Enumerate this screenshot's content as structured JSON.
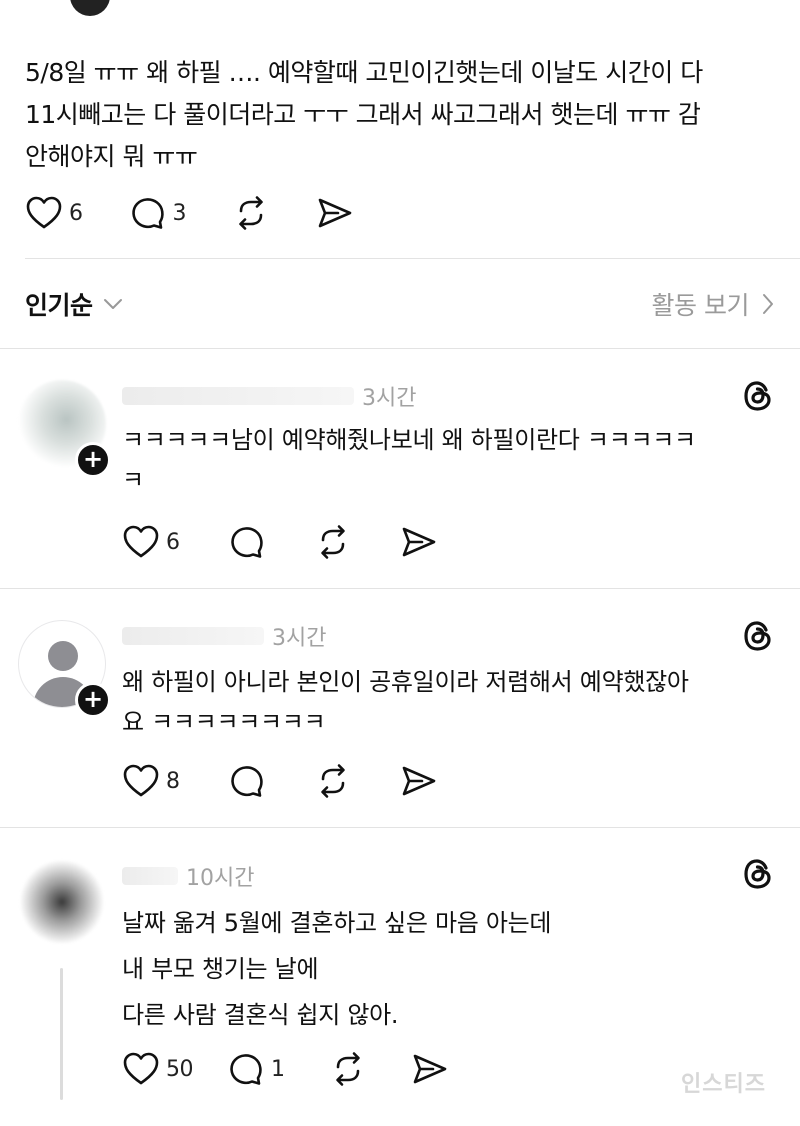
{
  "post": {
    "lines": [
      "5/8일 ㅠㅠ 왜 하필 …. 예약할때 고민이긴햇는데 이날도 시간이 다",
      "11시빼고는 다 풀이더라고 ㅜㅜ 그래서 싸고그래서 햇는데 ㅠㅠ 감",
      "안해야지 뭐 ㅠㅠ"
    ],
    "likes": "6",
    "replies": "3"
  },
  "sort": {
    "label": "인기순",
    "activity_label": "활동 보기"
  },
  "comments": [
    {
      "time": "3시간",
      "lines": [
        "ㅋㅋㅋㅋㅋ남이 예약해줬나보네 왜 하필이란다 ㅋㅋㅋㅋㅋ",
        "ㅋ"
      ],
      "likes": "6",
      "replies": ""
    },
    {
      "time": "3시간",
      "lines": [
        "왜 하필이 아니라 본인이 공휴일이라 저렴해서 예약했잖아",
        "요 ㅋㅋㅋㅋㅋㅋㅋㅋ"
      ],
      "likes": "8",
      "replies": ""
    },
    {
      "time": "10시간",
      "lines": [
        "날짜 옮겨 5월에 결혼하고 싶은 마음 아는데",
        "내 부모 챙기는 날에",
        "다른 사람 결혼식 쉽지 않아."
      ],
      "likes": "50",
      "replies": "1"
    }
  ],
  "watermark": "인스티즈",
  "icons": {
    "like": "heart-icon",
    "reply": "comment-bubble-icon",
    "repost": "repost-icon",
    "share": "send-icon",
    "threads": "threads-logo-icon",
    "follow": "plus-icon"
  }
}
